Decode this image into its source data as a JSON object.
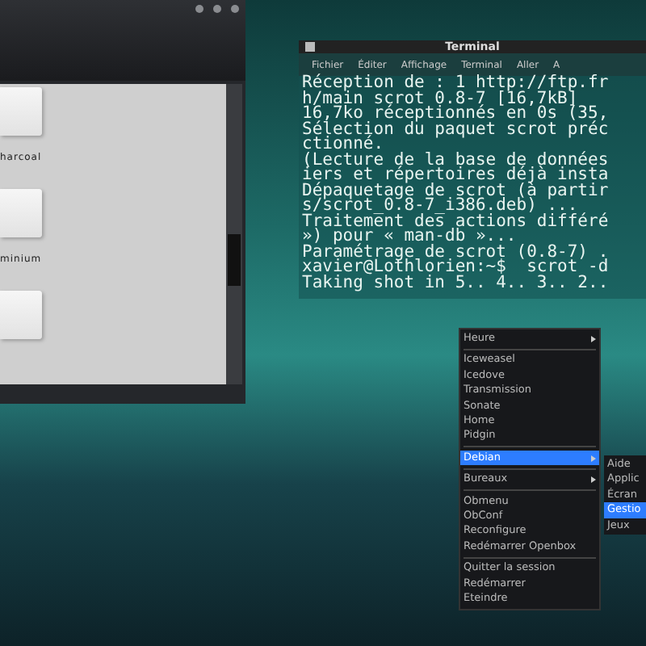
{
  "file_manager": {
    "items": [
      {
        "kind": "folder",
        "label": "harcoal"
      },
      {
        "kind": "folder",
        "label": "minium"
      },
      {
        "kind": "folder"
      }
    ]
  },
  "terminal": {
    "title": "Terminal",
    "menu": [
      "Fichier",
      "Éditer",
      "Affichage",
      "Terminal",
      "Aller",
      "A"
    ],
    "lines": [
      "Réception de : 1 http://ftp.fr",
      "h/main scrot 0.8-7 [16,7kB]",
      "16,7ko réceptionnés en 0s (35,",
      "Sélection du paquet scrot préc",
      "ctionné.",
      "(Lecture de la base de données",
      "iers et répertoires déjà insta",
      "Dépaquetage de scrot (à partir",
      "s/scrot_0.8-7_i386.deb) ...",
      "Traitement des actions différé",
      "») pour « man-db »...",
      "Paramétrage de scrot (0.8-7) .",
      "xavier@Lothlorien:~$  scrot -d",
      "Taking shot in 5.. 4.. 3.. 2.."
    ]
  },
  "menu": {
    "items": [
      {
        "kind": "submenu",
        "label": "Heure",
        "selected": false
      },
      {
        "kind": "separator"
      },
      {
        "kind": "item",
        "label": "Iceweasel",
        "selected": false
      },
      {
        "kind": "item",
        "label": "Icedove",
        "selected": false
      },
      {
        "kind": "item",
        "label": "Transmission",
        "selected": false
      },
      {
        "kind": "item",
        "label": "Sonate",
        "selected": false
      },
      {
        "kind": "item",
        "label": "Home",
        "selected": false
      },
      {
        "kind": "item",
        "label": "Pidgin",
        "selected": false
      },
      {
        "kind": "separator"
      },
      {
        "kind": "submenu",
        "label": "Debian",
        "selected": true
      },
      {
        "kind": "separator"
      },
      {
        "kind": "submenu",
        "label": "Bureaux",
        "selected": false
      },
      {
        "kind": "separator"
      },
      {
        "kind": "item",
        "label": "Obmenu",
        "selected": false
      },
      {
        "kind": "item",
        "label": "ObConf",
        "selected": false
      },
      {
        "kind": "item",
        "label": "Reconfigure",
        "selected": false
      },
      {
        "kind": "item",
        "label": "Redémarrer Openbox",
        "selected": false
      },
      {
        "kind": "separator"
      },
      {
        "kind": "item",
        "label": "Quitter la session",
        "selected": false
      },
      {
        "kind": "item",
        "label": "Redémarrer",
        "selected": false
      },
      {
        "kind": "item",
        "label": "Eteindre",
        "selected": false
      }
    ]
  },
  "submenu": {
    "items": [
      {
        "label": "Aide",
        "selected": false
      },
      {
        "label": "Applic",
        "selected": false
      },
      {
        "label": "Écran",
        "selected": false
      },
      {
        "label": "Gestio",
        "selected": true
      },
      {
        "label": "Jeux",
        "selected": false
      }
    ]
  }
}
